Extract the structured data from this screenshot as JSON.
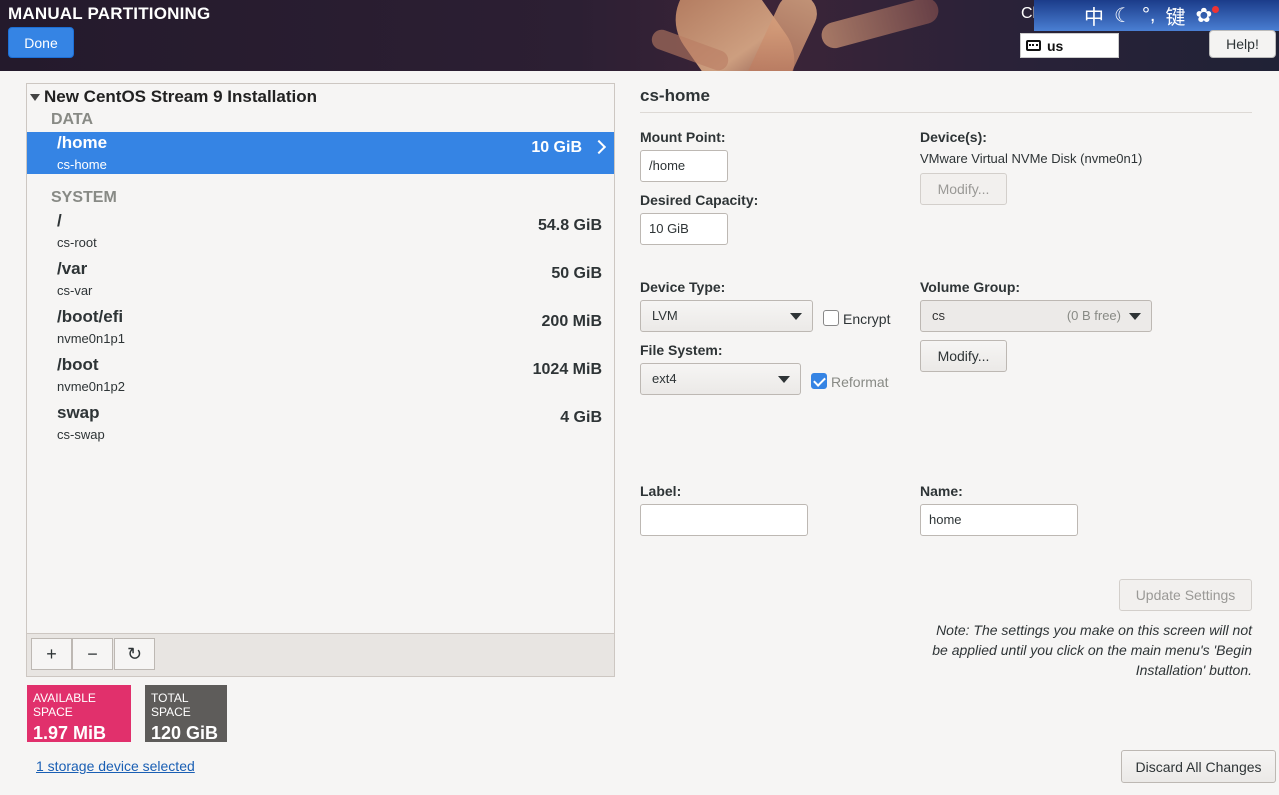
{
  "header": {
    "title": "MANUAL PARTITIONING",
    "done_label": "Done",
    "cut_text": "Cl",
    "keyboard_layout": "us",
    "help_label": "Help!",
    "ime_glyphs": [
      "中",
      "☾",
      "°,",
      "键",
      "✿"
    ]
  },
  "tree": {
    "root_label": "New CentOS Stream 9 Installation",
    "sections": [
      {
        "label": "DATA",
        "items": [
          {
            "mount": "/home",
            "device": "cs-home",
            "size": "10 GiB",
            "selected": true
          }
        ]
      },
      {
        "label": "SYSTEM",
        "items": [
          {
            "mount": "/",
            "device": "cs-root",
            "size": "54.8 GiB"
          },
          {
            "mount": "/var",
            "device": "cs-var",
            "size": "50 GiB"
          },
          {
            "mount": "/boot/efi",
            "device": "nvme0n1p1",
            "size": "200 MiB"
          },
          {
            "mount": "/boot",
            "device": "nvme0n1p2",
            "size": "1024 MiB"
          },
          {
            "mount": "swap",
            "device": "cs-swap",
            "size": "4 GiB"
          }
        ]
      }
    ],
    "toolbar": {
      "add": "+",
      "remove": "−",
      "refresh": "↻"
    }
  },
  "space": {
    "available_label": "AVAILABLE SPACE",
    "available_value": "1.97 MiB",
    "available_color": "#e01b24",
    "total_label": "TOTAL SPACE",
    "total_value": "120 GiB",
    "total_color": "#5e5c64"
  },
  "storage_link": "1 storage device selected",
  "details": {
    "title": "cs-home",
    "mount_point_label": "Mount Point:",
    "mount_point_value": "/home",
    "capacity_label": "Desired Capacity:",
    "capacity_value": "10 GiB",
    "devices_label": "Device(s):",
    "devices_value": "VMware Virtual NVMe Disk (nvme0n1)",
    "devices_modify": "Modify...",
    "device_type_label": "Device Type:",
    "device_type_value": "LVM",
    "encrypt_label": "Encrypt",
    "volume_group_label": "Volume Group:",
    "volume_group_value": "cs",
    "volume_group_free": "(0 B free)",
    "vg_modify": "Modify...",
    "filesystem_label": "File System:",
    "filesystem_value": "ext4",
    "reformat_label": "Reformat",
    "label_label": "Label:",
    "label_value": "",
    "name_label": "Name:",
    "name_value": "home",
    "update_label": "Update Settings",
    "note": "Note:  The settings you make on this screen will not be applied until you click on the main menu's 'Begin Installation' button."
  },
  "discard_label": "Discard All Changes",
  "accent_color": "#3584e4"
}
